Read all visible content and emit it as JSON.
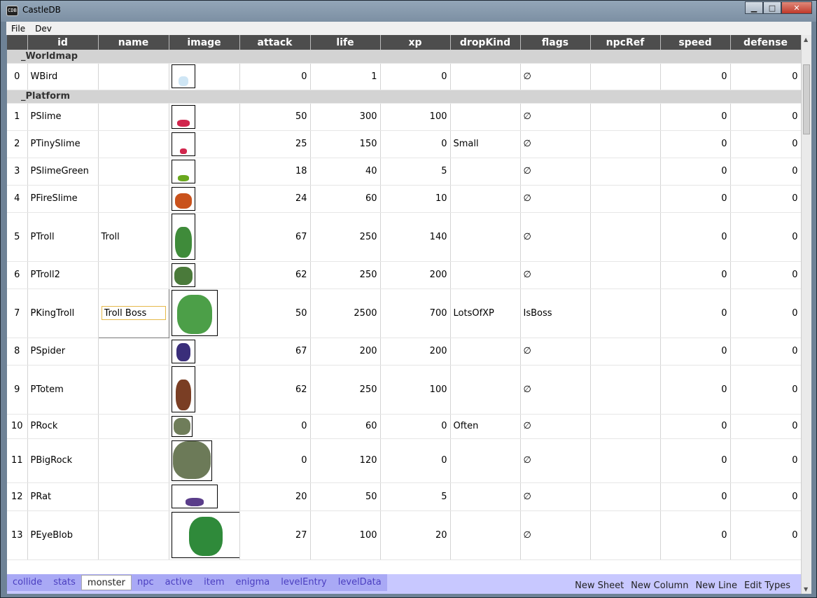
{
  "window": {
    "title": "CastleDB",
    "icon_text": "CDB",
    "minimize": "▁",
    "maximize": "□",
    "close": "✕"
  },
  "menu": [
    "File",
    "Dev"
  ],
  "columns": [
    "id",
    "name",
    "image",
    "attack",
    "life",
    "xp",
    "dropKind",
    "flags",
    "npcRef",
    "speed",
    "defense"
  ],
  "sections": [
    {
      "title": "_Worldmap",
      "rows": [
        {
          "index": "0",
          "id": "WBird",
          "name": "",
          "image": "bird-sprite",
          "attack": "0",
          "life": "1",
          "xp": "0",
          "dropKind": "",
          "flags": "∅",
          "npcRef": "",
          "speed": "0",
          "defense": "0"
        }
      ]
    },
    {
      "title": "_Platform",
      "rows": [
        {
          "index": "1",
          "id": "PSlime",
          "name": "",
          "image": "slime-sprite",
          "attack": "50",
          "life": "300",
          "xp": "100",
          "dropKind": "",
          "flags": "∅",
          "npcRef": "",
          "speed": "0",
          "defense": "0"
        },
        {
          "index": "2",
          "id": "PTinySlime",
          "name": "",
          "image": "tiny-slime-sprite",
          "attack": "25",
          "life": "150",
          "xp": "0",
          "dropKind": "Small",
          "flags": "∅",
          "npcRef": "",
          "speed": "0",
          "defense": "0"
        },
        {
          "index": "3",
          "id": "PSlimeGreen",
          "name": "",
          "image": "green-slime-sprite",
          "attack": "18",
          "life": "40",
          "xp": "5",
          "dropKind": "",
          "flags": "∅",
          "npcRef": "",
          "speed": "0",
          "defense": "0"
        },
        {
          "index": "4",
          "id": "PFireSlime",
          "name": "",
          "image": "fire-slime-sprite",
          "attack": "24",
          "life": "60",
          "xp": "10",
          "dropKind": "",
          "flags": "∅",
          "npcRef": "",
          "speed": "0",
          "defense": "0"
        },
        {
          "index": "5",
          "id": "PTroll",
          "name": "Troll",
          "image": "troll-sprite",
          "attack": "67",
          "life": "250",
          "xp": "140",
          "dropKind": "",
          "flags": "∅",
          "npcRef": "",
          "speed": "0",
          "defense": "0"
        },
        {
          "index": "6",
          "id": "PTroll2",
          "name": "",
          "image": "troll2-sprite",
          "attack": "62",
          "life": "250",
          "xp": "200",
          "dropKind": "",
          "flags": "∅",
          "npcRef": "",
          "speed": "0",
          "defense": "0"
        },
        {
          "index": "7",
          "id": "PKingTroll",
          "name": "Troll Boss",
          "image": "king-troll-sprite",
          "attack": "50",
          "life": "2500",
          "xp": "700",
          "dropKind": "LotsOfXP",
          "flags": "IsBoss",
          "npcRef": "",
          "speed": "0",
          "defense": "0"
        },
        {
          "index": "8",
          "id": "PSpider",
          "name": "",
          "image": "spider-sprite",
          "attack": "67",
          "life": "200",
          "xp": "200",
          "dropKind": "",
          "flags": "∅",
          "npcRef": "",
          "speed": "0",
          "defense": "0"
        },
        {
          "index": "9",
          "id": "PTotem",
          "name": "",
          "image": "totem-sprite",
          "attack": "62",
          "life": "250",
          "xp": "100",
          "dropKind": "",
          "flags": "∅",
          "npcRef": "",
          "speed": "0",
          "defense": "0"
        },
        {
          "index": "10",
          "id": "PRock",
          "name": "",
          "image": "rock-sprite",
          "attack": "0",
          "life": "60",
          "xp": "0",
          "dropKind": "Often",
          "flags": "∅",
          "npcRef": "",
          "speed": "0",
          "defense": "0"
        },
        {
          "index": "11",
          "id": "PBigRock",
          "name": "",
          "image": "big-rock-sprite",
          "attack": "0",
          "life": "120",
          "xp": "0",
          "dropKind": "",
          "flags": "∅",
          "npcRef": "",
          "speed": "0",
          "defense": "0"
        },
        {
          "index": "12",
          "id": "PRat",
          "name": "",
          "image": "rat-sprite",
          "attack": "20",
          "life": "50",
          "xp": "5",
          "dropKind": "",
          "flags": "∅",
          "npcRef": "",
          "speed": "0",
          "defense": "0"
        },
        {
          "index": "13",
          "id": "PEyeBlob",
          "name": "",
          "image": "eye-blob-sprite",
          "attack": "27",
          "life": "100",
          "xp": "20",
          "dropKind": "",
          "flags": "∅",
          "npcRef": "",
          "speed": "0",
          "defense": "0"
        }
      ]
    }
  ],
  "editing": {
    "row_index": "7",
    "value": "Troll Boss"
  },
  "sheets": [
    "collide",
    "stats",
    "monster",
    "npc",
    "active",
    "item",
    "enigma",
    "levelEntry",
    "levelData"
  ],
  "active_sheet": "monster",
  "actions": [
    "New Sheet",
    "New Column",
    "New Line",
    "Edit Types"
  ],
  "colors": {
    "header_bg": "#4d4d4d",
    "section_bg": "#d3d3d3",
    "tabbar_bg": "#c8c8ff",
    "tab_text": "#4b3fc0",
    "edit_border": "#e6b94a"
  }
}
